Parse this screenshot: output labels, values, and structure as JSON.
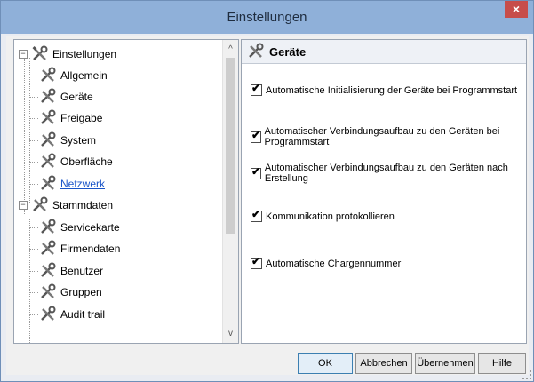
{
  "window": {
    "title": "Einstellungen",
    "close_glyph": "×"
  },
  "tree": {
    "items": [
      {
        "label": "Einstellungen",
        "icon": "tools-icon",
        "level": 0,
        "expander": "−"
      },
      {
        "label": "Allgemein",
        "icon": "tools-icon",
        "level": 1
      },
      {
        "label": "Geräte",
        "icon": "tools-icon",
        "level": 1
      },
      {
        "label": "Freigabe",
        "icon": "tools-icon",
        "level": 1
      },
      {
        "label": "System",
        "icon": "tools-icon",
        "level": 1
      },
      {
        "label": "Oberfläche",
        "icon": "tools-icon",
        "level": 1
      },
      {
        "label": "Netzwerk",
        "icon": "tools-icon",
        "level": 1,
        "link": true
      },
      {
        "label": "Stammdaten",
        "icon": "tools-icon",
        "level": 0,
        "expander": "−"
      },
      {
        "label": "Servicekarte",
        "icon": "tools-icon",
        "level": 1
      },
      {
        "label": "Firmendaten",
        "icon": "tools-icon",
        "level": 1
      },
      {
        "label": "Benutzer",
        "icon": "tools-icon",
        "level": 1
      },
      {
        "label": "Gruppen",
        "icon": "tools-icon",
        "level": 1
      },
      {
        "label": "Audit trail",
        "icon": "tools-icon",
        "level": 1
      }
    ],
    "scroll_up": "^",
    "scroll_down": "v"
  },
  "panel": {
    "header": "Geräte",
    "options": [
      {
        "label": "Automatische Initialisierung der Geräte bei Programmstart",
        "checked": true
      },
      {
        "label": "Automatischer Verbindungsaufbau zu den Geräten bei Programmstart",
        "checked": true
      },
      {
        "label": "Automatischer Verbindungsaufbau zu den Geräten nach Erstellung",
        "checked": true
      },
      {
        "label": "Kommunikation protokollieren",
        "checked": true
      },
      {
        "label": "Automatische Chargennummer",
        "checked": true
      }
    ],
    "check_glyph": "✔"
  },
  "buttons": {
    "ok": "OK",
    "cancel": "Abbrechen",
    "apply": "Übernehmen",
    "help": "Hilfe"
  }
}
